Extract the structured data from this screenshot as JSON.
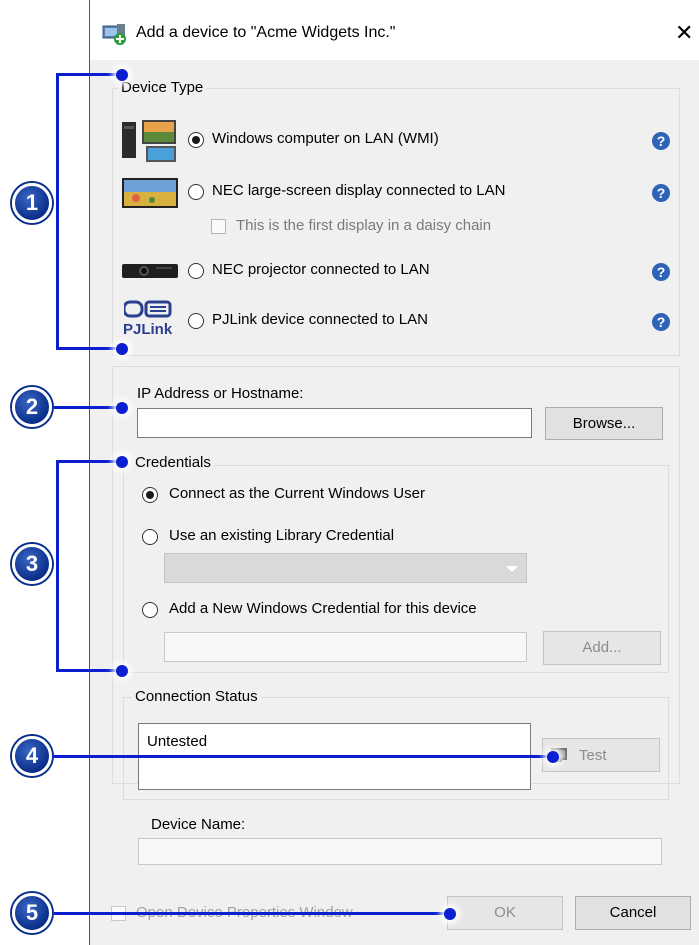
{
  "dialog": {
    "title": "Add a device to \"Acme Widgets Inc.\"",
    "close_icon": "close-icon",
    "title_icon": "add-device-icon"
  },
  "device_type": {
    "legend": "Device Type",
    "options": [
      {
        "label": "Windows computer on LAN (WMI)",
        "checked": true,
        "icon": "windows-computer-icon",
        "help": true
      },
      {
        "label": "NEC large-screen display connected to LAN",
        "checked": false,
        "icon": "large-screen-display-icon",
        "help": true
      },
      {
        "label": "NEC projector connected to LAN",
        "checked": false,
        "icon": "projector-icon",
        "help": true
      },
      {
        "label": "PJLink device connected to LAN",
        "checked": false,
        "icon": "pjlink-icon",
        "help": true
      }
    ],
    "daisy_chain_label": "This is the first display in a daisy chain",
    "pjlink_logo": "PJLink",
    "help_glyph": "?"
  },
  "address": {
    "label": "IP Address or Hostname:",
    "value": "",
    "browse_label": "Browse..."
  },
  "credentials": {
    "legend": "Credentials",
    "options": [
      {
        "label": "Connect as the Current Windows User",
        "checked": true
      },
      {
        "label": "Use an existing Library Credential",
        "checked": false
      },
      {
        "label": "Add a New Windows Credential for this device",
        "checked": false
      }
    ],
    "add_label": "Add..."
  },
  "connection_status": {
    "legend": "Connection Status",
    "value": "Untested",
    "test_label": "Test",
    "test_icon": "network-test-icon"
  },
  "device_name": {
    "label": "Device Name:",
    "value": ""
  },
  "footer": {
    "open_properties_label": "Open Device Properties Window",
    "ok_label": "OK",
    "cancel_label": "Cancel"
  },
  "callouts": [
    "1",
    "2",
    "3",
    "4",
    "5"
  ],
  "colors": {
    "callout_fill": "#0a2f8a",
    "callout_line": "#0a1fd0",
    "help_icon": "#2f63b8",
    "dialog_background": "#f0f0f0"
  }
}
